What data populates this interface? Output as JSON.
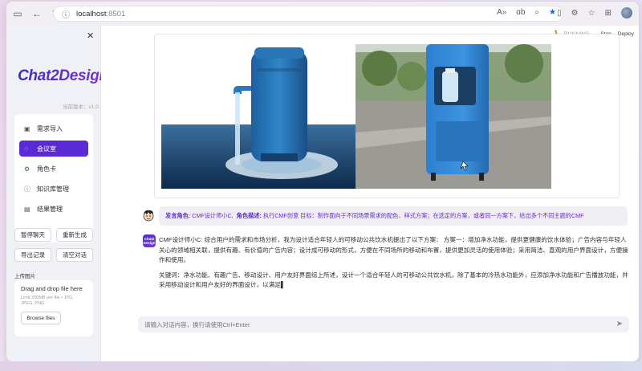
{
  "browser": {
    "url_host": "localhost",
    "url_port": ":8501"
  },
  "sidebar": {
    "logo": "Chat2Design",
    "version": "当前版本：v1.0",
    "menu": [
      {
        "label": "需求导入",
        "icon": "document-icon"
      },
      {
        "label": "会议室",
        "icon": "chat-bubble-icon",
        "active": true
      },
      {
        "label": "角色卡",
        "icon": "gear-icon"
      },
      {
        "label": "知识库管理",
        "icon": "info-icon"
      },
      {
        "label": "结果管理",
        "icon": "list-icon"
      }
    ],
    "buttons": {
      "pause": "暂停聊天",
      "regenerate": "重新生成",
      "export": "导出记录",
      "clear": "清空对话"
    },
    "upload": {
      "label": "上传图片",
      "drop_title": "Drag and drop file here",
      "hint": "Limit 200MB per file • JPG, JPEG, PNG",
      "browse": "Browse files"
    }
  },
  "header": {
    "running": "RUNNING...",
    "stop": "Stop",
    "deploy": "Deploy"
  },
  "chat": {
    "role_prefix": "发言角色:",
    "role_value": "CMF设计师小C,",
    "desc_prefix": "角色描述:",
    "desc_value": "执行CMF创意 目标：制作面向于不同场景需求的配色、样式方案；在选定的方案，或者同一方案下，给出多个不同主题的CMF",
    "answer_p1": "CMF设计师小C: 综合用户的需求和市场分析，我为设计适合年轻人的可移动公共饮水机提出了以下方案：  方案一：增加净水功能，提供更健康的饮水体验；广告内容与年轻人关心的领域相关联，提供有趣、有价值的广告内容；设计成可移动的形式，方便在不同场所的移动和布置，提供更加灵活的使用体验；采用简洁、直观的用户界面设计，方便操作和使用。",
    "answer_p2": "关键词：净水功能、有趣广告、移动设计、用户友好界面综上所述，设计一个适合年轻人的可移动公共饮水机，除了基本的冷热水功能外，应添加净水功能和广告播放功能，并采用移动设计和用户友好的界面设计，以满足▌",
    "input_placeholder": "请输入对话内容，换行请使用Ctrl+Enter"
  },
  "colors": {
    "accent": "#5a2bd4",
    "link": "#1a62d6"
  }
}
